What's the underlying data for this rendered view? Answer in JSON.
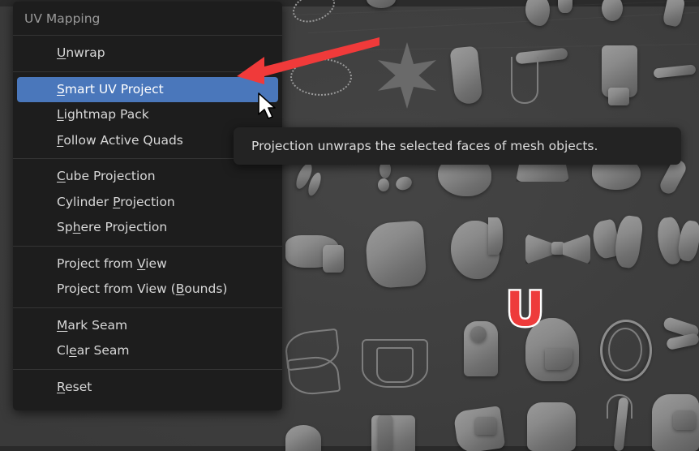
{
  "app": {
    "viewport_name": "3d-viewport",
    "background_color": "#3c3c3c"
  },
  "menu": {
    "title": "UV Mapping",
    "highlight_color": "#4a77bb",
    "background_color": "#1d1d1d",
    "groups": [
      {
        "items": [
          {
            "label": "Unwrap",
            "accel": "U",
            "selected": false
          }
        ]
      },
      {
        "items": [
          {
            "label": "Smart UV Project",
            "accel": "S",
            "selected": true
          },
          {
            "label": "Lightmap Pack",
            "accel": "L",
            "selected": false
          },
          {
            "label": "Follow Active Quads",
            "accel": "F",
            "selected": false
          }
        ]
      },
      {
        "items": [
          {
            "label": "Cube Projection",
            "accel": "C",
            "selected": false
          },
          {
            "label": "Cylinder Projection",
            "accel": "P",
            "selected": false
          },
          {
            "label": "Sphere Projection",
            "accel": "h",
            "selected": false
          }
        ]
      },
      {
        "items": [
          {
            "label": "Project from View",
            "accel": "V",
            "selected": false
          },
          {
            "label": "Project from View (Bounds)",
            "accel": "B",
            "selected": false
          }
        ]
      },
      {
        "items": [
          {
            "label": "Mark Seam",
            "accel": "M",
            "selected": false
          },
          {
            "label": "Clear Seam",
            "accel": "e",
            "selected": false
          }
        ]
      },
      {
        "items": [
          {
            "label": "Reset",
            "accel": "R",
            "selected": false
          }
        ]
      }
    ]
  },
  "tooltip": {
    "text": "Projection unwraps the selected faces of mesh objects."
  },
  "annotation": {
    "arrow_color": "#f03a3a",
    "arrow_name": "red-pointer-arrow"
  },
  "keypress": {
    "key": "U",
    "fill_color": "#ee3b3b",
    "outline_color": "#ffffff"
  },
  "cursor": {
    "name": "mouse-pointer"
  }
}
